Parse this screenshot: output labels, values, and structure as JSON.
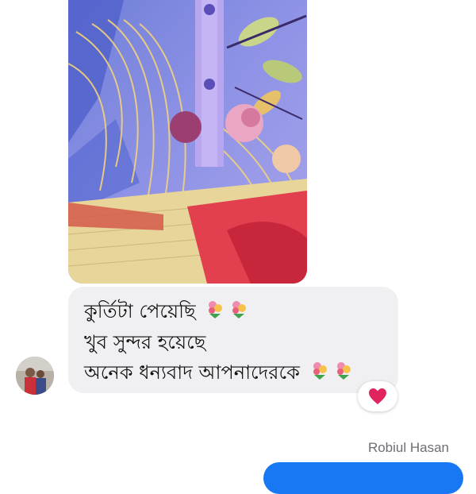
{
  "conversation": {
    "incoming_message": {
      "lines": [
        {
          "text": "কুর্তিটা পেয়েছি",
          "emoji": "bouquet-emoji",
          "emoji_count": 2
        },
        {
          "text": "খুব সুন্দর হয়েছে",
          "emoji": null,
          "emoji_count": 0
        },
        {
          "text": "অনেক ধন্যবাদ আপনাদেরকে",
          "emoji": "bouquet-emoji",
          "emoji_count": 2
        }
      ],
      "reaction": "heart-emoji",
      "attachment": "photo-of-kurti-fabric"
    },
    "outgoing_sender_name": "Robiul Hasan"
  },
  "colors": {
    "incoming_bubble": "#f0f0f2",
    "outgoing_bubble": "#1877f2",
    "reaction_heart": "#e0245e",
    "sender_label": "#6e6e73"
  }
}
